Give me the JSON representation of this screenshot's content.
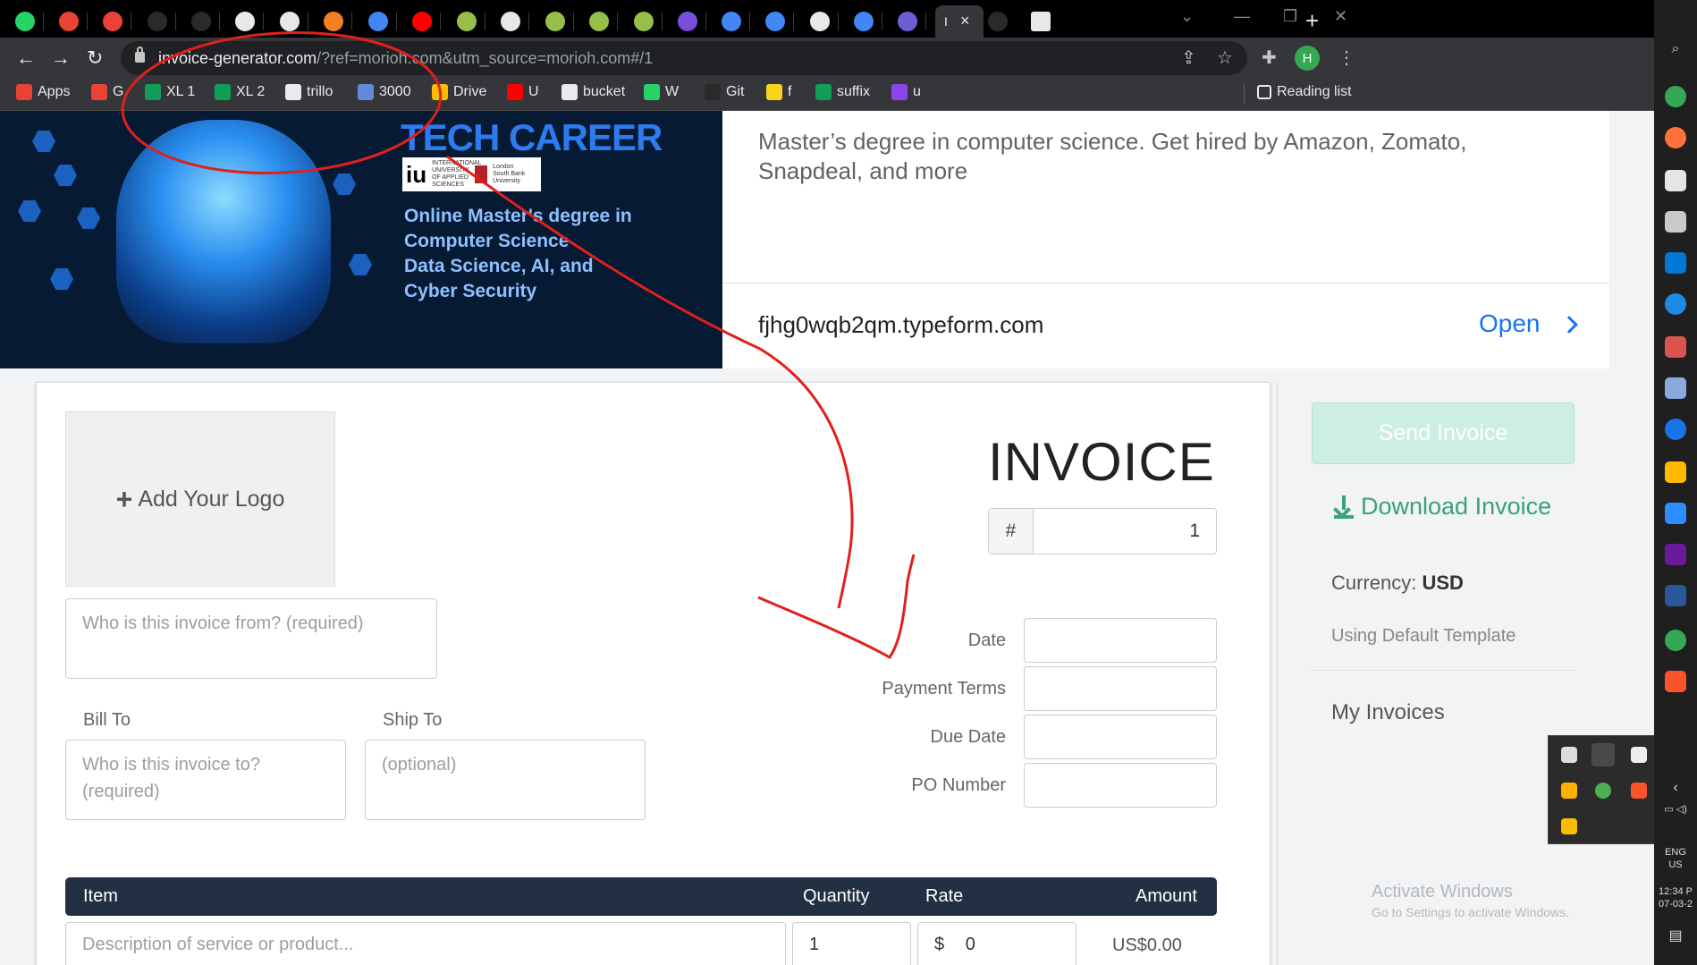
{
  "browser": {
    "active_tab_title": "I",
    "new_tab_symbol": "+",
    "url_host": "invoice-generator.com",
    "url_path": "/?ref=morioh.com&utm_source=morioh.com#/1",
    "profile_initial": "H",
    "tabs": [
      {
        "icon": "whatsapp-icon",
        "color": "#25d366"
      },
      {
        "icon": "gmail-icon",
        "color": "#ea4335"
      },
      {
        "icon": "gmail-icon",
        "color": "#ea4335"
      },
      {
        "icon": "github-icon",
        "color": "#2a2a2a"
      },
      {
        "icon": "github-icon",
        "color": "#2a2a2a"
      },
      {
        "icon": "sheets-icon",
        "color": "#e8e8e8"
      },
      {
        "icon": "globe-icon",
        "color": "#e8e8e8"
      },
      {
        "icon": "app-icon",
        "color": "#f48024"
      },
      {
        "icon": "google-icon",
        "color": "#4285f4"
      },
      {
        "icon": "youtube-icon",
        "color": "#ff0000"
      },
      {
        "icon": "shopify-icon",
        "color": "#95bf47"
      },
      {
        "icon": "globe-icon",
        "color": "#e8e8e8"
      },
      {
        "icon": "shopify-icon",
        "color": "#95bf47"
      },
      {
        "icon": "shopify-icon",
        "color": "#95bf47"
      },
      {
        "icon": "shopify-icon",
        "color": "#95bf47"
      },
      {
        "icon": "app-icon",
        "color": "#7b4ddb"
      },
      {
        "icon": "google-icon",
        "color": "#4285f4"
      },
      {
        "icon": "google-icon",
        "color": "#4285f4"
      },
      {
        "icon": "chrome-icon",
        "color": "#e8e8e8"
      },
      {
        "icon": "google-icon",
        "color": "#4285f4"
      },
      {
        "icon": "app-icon",
        "color": "#6d5fd3"
      }
    ]
  },
  "bookmarks": [
    {
      "label": "Apps",
      "icon": "apps-grid-icon",
      "color": "#ea4335"
    },
    {
      "label": "G",
      "icon": "gmail-icon",
      "color": "#ea4335"
    },
    {
      "label": "XL 1",
      "icon": "sheets-icon",
      "color": "#0f9d58"
    },
    {
      "label": "XL 2",
      "icon": "sheets-icon",
      "color": "#0f9d58"
    },
    {
      "label": "trillo",
      "icon": "trello-icon",
      "color": "#e8eaed"
    },
    {
      "label": "3000",
      "icon": "app-icon",
      "color": "#5f8cd8"
    },
    {
      "label": "Drive",
      "icon": "drive-icon",
      "color": "#fbbc04"
    },
    {
      "label": "U",
      "icon": "youtube-icon",
      "color": "#ff0000"
    },
    {
      "label": "bucket",
      "icon": "globe-icon",
      "color": "#e8eaed"
    },
    {
      "label": "W",
      "icon": "whatsapp-icon",
      "color": "#25d366"
    },
    {
      "label": "Git",
      "icon": "github-icon",
      "color": "#2a2a2a"
    },
    {
      "label": "f",
      "icon": "flipkart-icon",
      "color": "#f7d51d"
    },
    {
      "label": "suffix",
      "icon": "sheets-icon",
      "color": "#0f9d58"
    },
    {
      "label": "u",
      "icon": "app-icon",
      "color": "#8e44ec"
    }
  ],
  "reading_list": "Reading list",
  "ad": {
    "title": "TECH CAREER",
    "logo_iu": "iu",
    "logo_iu_sub": "INTERNATIONAL UNIVERSITY OF APPLIED SCIENCES",
    "logo_lsbu": "London South Bank University",
    "copy": "Online Master's degree in\nComputer Science\nData Science, AI, and\nCyber Security",
    "description": "Master’s degree in computer science. Get hired by Amazon, Zomato, Snapdeal, and more",
    "domain": "fjhg0wqb2qm.typeform.com",
    "open_label": "Open"
  },
  "invoice": {
    "add_logo": "Add Your Logo",
    "from_placeholder": "Who is this invoice from? (required)",
    "bill_to_label": "Bill To",
    "ship_to_label": "Ship To",
    "bill_to_placeholder": "Who is this invoice to?\n(required)",
    "ship_to_placeholder": "(optional)",
    "title": "INVOICE",
    "number_prefix": "#",
    "number": "1",
    "date_label": "Date",
    "payment_terms_label": "Payment Terms",
    "due_date_label": "Due Date",
    "po_number_label": "PO Number",
    "columns": {
      "item": "Item",
      "quantity": "Quantity",
      "rate": "Rate",
      "amount": "Amount"
    },
    "row": {
      "description_placeholder": "Description of service or product...",
      "quantity": "1",
      "rate_symbol": "$",
      "rate": "0",
      "amount": "US$0.00"
    }
  },
  "sidebar": {
    "send_invoice": "Send Invoice",
    "download_invoice": "Download Invoice",
    "currency_label": "Currency:",
    "currency_value": "USD",
    "template": "Using Default Template",
    "my_invoices": "My Invoices"
  },
  "watermark": {
    "line1": "Activate Windows",
    "line2": "Go to Settings to activate Windows."
  },
  "taskbar": {
    "language": "ENG",
    "region": "US",
    "time": "12:34 P",
    "date": "07-03-2"
  },
  "colors": {
    "annotation": "#e0201b",
    "accent_green": "#3aa17e",
    "table_header": "#233044",
    "link_blue": "#1a73e8"
  }
}
